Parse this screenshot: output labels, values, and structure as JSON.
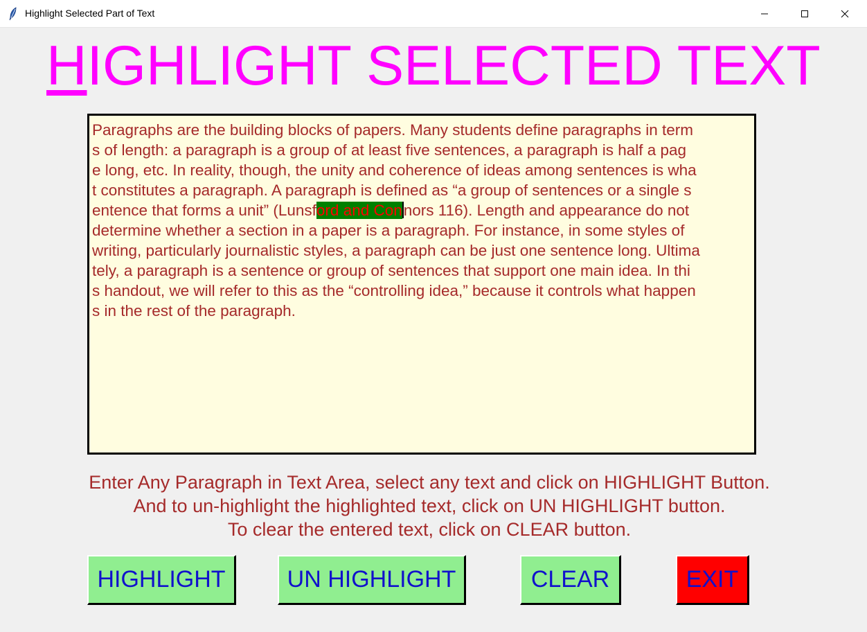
{
  "window": {
    "title": "Highlight Selected Part of Text",
    "controls": [
      "minimize-icon",
      "maximize-icon",
      "close-icon"
    ]
  },
  "header": {
    "title_first_letter": "H",
    "title_rest": "IGHLIGHT SELECTED TEXT",
    "color": "#ff00ff"
  },
  "text_area": {
    "background": "#fffde0",
    "text_color": "#a52a2a",
    "highlight_background": "#008000",
    "highlight_color": "#ff0000",
    "lines": [
      "Paragraphs are the building blocks of papers. Many students define paragraphs in term",
      "s of length: a paragraph is a group of at least five sentences, a paragraph is half a pag",
      "e long, etc. In reality, though, the unity and coherence of ideas among sentences is wha",
      "t constitutes a paragraph. A paragraph is defined as “a group of sentences or a single s"
    ],
    "line5": {
      "before": "entence that forms a unit” (Lunsf",
      "highlighted": "ord and Con",
      "after": "nors 116). Length and appearance do not"
    },
    "lines_after": [
      "determine whether a section in a paper is a paragraph. For instance, in some styles of",
      "writing, particularly journalistic styles, a paragraph can be just one sentence long. Ultima",
      "tely, a paragraph is a sentence or group of sentences that support one main idea. In thi",
      "s handout, we will refer to this as the “controlling idea,” because it controls what happen",
      "s in the rest of the paragraph."
    ]
  },
  "instructions": [
    "Enter Any Paragraph in Text Area, select any text and click on HIGHLIGHT Button.",
    "And to un-highlight the highlighted text, click on UN HIGHLIGHT button.",
    "To clear the entered text, click on CLEAR button."
  ],
  "buttons": {
    "highlight": "HIGHLIGHT",
    "unhighlight": "UN HIGHLIGHT",
    "clear": "CLEAR",
    "exit": "EXIT"
  },
  "colors": {
    "button_green": "#90ee90",
    "button_red": "#ff0000",
    "button_text": "#1111cc"
  }
}
